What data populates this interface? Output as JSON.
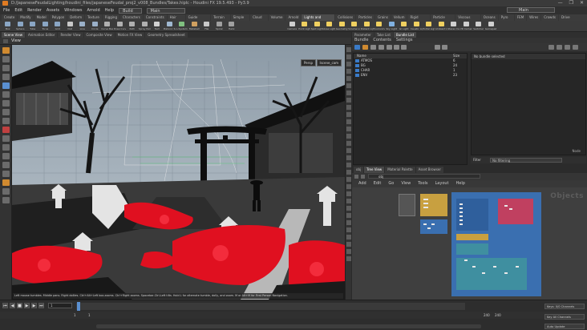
{
  "title_bar": {
    "text": "D:/JapaneseFeudalLighting/houdini_files/japaneseFeudal_proj2_v008_Bundles/Takes.hiplc - Houdini FX 19.5.493 - Py3.9",
    "controls": [
      "—",
      "❐",
      "✕"
    ]
  },
  "menu": {
    "items": [
      "File",
      "Edit",
      "Render",
      "Assets",
      "Windows",
      "Arnold",
      "Help"
    ],
    "build_label": "Build",
    "main_label": "Main",
    "main_right": "Main"
  },
  "shelf_tabs": [
    "Create",
    "Modify",
    "Model",
    "Polygon",
    "Deform",
    "Texture",
    "Rigging",
    "Characters",
    "Constraints",
    "Hair Utils",
    "Guide Process",
    "Terrain FX",
    "Simple FX",
    "Cloud FX",
    "Volume",
    "Arnold",
    "Lights and Cameras",
    "Collisions",
    "Particles",
    "Grains",
    "Vellum",
    "Rigid Bodies",
    "Particle Fluids",
    "Viscous Fluids",
    "Oceans",
    "Pyro FX",
    "FEM",
    "Wires",
    "Crowds",
    "Drive Simulation"
  ],
  "shelf_tools": [
    "Box",
    "Sphere",
    "Tube",
    "Torus",
    "Grid",
    "Null",
    "Line",
    "Circle",
    "Curve Bezier",
    "Draw Curve",
    "Path",
    "Spray Paint",
    "Text",
    "Platonic Solids",
    "L-System",
    "Metaball",
    "File",
    "Spiral",
    "Helix",
    "Camera",
    "Point Light",
    "Spot Light",
    "Area Light",
    "Geometry Light",
    "Volume Light",
    "Distant Light",
    "Environment Light",
    "Sky Light",
    "GI Light",
    "Caustic Light",
    "Portal Light",
    "Ambient Light",
    "Stereo Camera",
    "VR Camera",
    "Switcher",
    "Gamepad Camera"
  ],
  "pane_tabs": [
    "Scene View",
    "Animation Editor",
    "Render View",
    "Composite View",
    "Motion FX View",
    "Geometry Spreadsheet"
  ],
  "viewer": {
    "title": "View",
    "path": "obj",
    "persp": "Persp",
    "camera": "Iscene_cam",
    "hint": "Left mouse tumbles. Middle pans. Right dollies. Ctrl+Alt+Left box-zooms. Ctrl+Right zooms. Spacebar-Ctrl-Left tilts. Hold L for alternate tumble, dolly, and zoom.    M or Alt+M for First Person Navigation."
  },
  "bundle_pane": {
    "tabs": [
      "Parameter",
      "Take List",
      "Bundle List"
    ],
    "menu": [
      "Bundle",
      "Contents",
      "Settings"
    ],
    "columns": {
      "name": "Name",
      "size": "Size"
    },
    "rows": [
      {
        "name": "ATMOS",
        "size": "6"
      },
      {
        "name": "BG",
        "size": "24"
      },
      {
        "name": "CHAR",
        "size": "1"
      },
      {
        "name": "ENV",
        "size": "23"
      }
    ],
    "detail_header": "No bundle selected",
    "detail_col": "Node",
    "filter_label": "Filter",
    "filter_value": "No filtering"
  },
  "network_pane": {
    "tabs": [
      "obj",
      "Tree View",
      "Material Palette",
      "Asset Browser"
    ],
    "path": "obj",
    "menu": [
      "Add",
      "Edit",
      "Go",
      "View",
      "Tools",
      "Layout",
      "Help"
    ],
    "watermark": "Objects"
  },
  "timeline": {
    "frame": "1",
    "start": "1",
    "end": "1",
    "range_end_a": "240",
    "range_end_b": "240",
    "status1": "Keys: 0/0 Channels",
    "status2": "Key All Channels",
    "status3": "Auto Update"
  },
  "colors": {
    "accent_orange": "#e07b22",
    "red_flowers": "#e01020",
    "sky": "#9aa8b4",
    "net_blue": "#3a6fb0",
    "net_gold": "#c8a040",
    "net_teal": "#3f8fa0",
    "net_rose": "#c04060"
  }
}
